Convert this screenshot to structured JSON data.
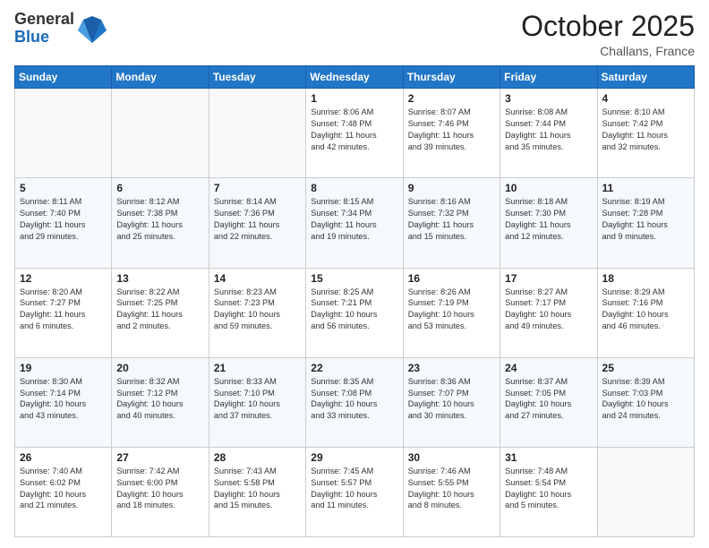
{
  "logo": {
    "general": "General",
    "blue": "Blue"
  },
  "header": {
    "month": "October 2025",
    "location": "Challans, France"
  },
  "weekdays": [
    "Sunday",
    "Monday",
    "Tuesday",
    "Wednesday",
    "Thursday",
    "Friday",
    "Saturday"
  ],
  "weeks": [
    [
      {
        "day": "",
        "info": ""
      },
      {
        "day": "",
        "info": ""
      },
      {
        "day": "",
        "info": ""
      },
      {
        "day": "1",
        "info": "Sunrise: 8:06 AM\nSunset: 7:48 PM\nDaylight: 11 hours\nand 42 minutes."
      },
      {
        "day": "2",
        "info": "Sunrise: 8:07 AM\nSunset: 7:46 PM\nDaylight: 11 hours\nand 39 minutes."
      },
      {
        "day": "3",
        "info": "Sunrise: 8:08 AM\nSunset: 7:44 PM\nDaylight: 11 hours\nand 35 minutes."
      },
      {
        "day": "4",
        "info": "Sunrise: 8:10 AM\nSunset: 7:42 PM\nDaylight: 11 hours\nand 32 minutes."
      }
    ],
    [
      {
        "day": "5",
        "info": "Sunrise: 8:11 AM\nSunset: 7:40 PM\nDaylight: 11 hours\nand 29 minutes."
      },
      {
        "day": "6",
        "info": "Sunrise: 8:12 AM\nSunset: 7:38 PM\nDaylight: 11 hours\nand 25 minutes."
      },
      {
        "day": "7",
        "info": "Sunrise: 8:14 AM\nSunset: 7:36 PM\nDaylight: 11 hours\nand 22 minutes."
      },
      {
        "day": "8",
        "info": "Sunrise: 8:15 AM\nSunset: 7:34 PM\nDaylight: 11 hours\nand 19 minutes."
      },
      {
        "day": "9",
        "info": "Sunrise: 8:16 AM\nSunset: 7:32 PM\nDaylight: 11 hours\nand 15 minutes."
      },
      {
        "day": "10",
        "info": "Sunrise: 8:18 AM\nSunset: 7:30 PM\nDaylight: 11 hours\nand 12 minutes."
      },
      {
        "day": "11",
        "info": "Sunrise: 8:19 AM\nSunset: 7:28 PM\nDaylight: 11 hours\nand 9 minutes."
      }
    ],
    [
      {
        "day": "12",
        "info": "Sunrise: 8:20 AM\nSunset: 7:27 PM\nDaylight: 11 hours\nand 6 minutes."
      },
      {
        "day": "13",
        "info": "Sunrise: 8:22 AM\nSunset: 7:25 PM\nDaylight: 11 hours\nand 2 minutes."
      },
      {
        "day": "14",
        "info": "Sunrise: 8:23 AM\nSunset: 7:23 PM\nDaylight: 10 hours\nand 59 minutes."
      },
      {
        "day": "15",
        "info": "Sunrise: 8:25 AM\nSunset: 7:21 PM\nDaylight: 10 hours\nand 56 minutes."
      },
      {
        "day": "16",
        "info": "Sunrise: 8:26 AM\nSunset: 7:19 PM\nDaylight: 10 hours\nand 53 minutes."
      },
      {
        "day": "17",
        "info": "Sunrise: 8:27 AM\nSunset: 7:17 PM\nDaylight: 10 hours\nand 49 minutes."
      },
      {
        "day": "18",
        "info": "Sunrise: 8:29 AM\nSunset: 7:16 PM\nDaylight: 10 hours\nand 46 minutes."
      }
    ],
    [
      {
        "day": "19",
        "info": "Sunrise: 8:30 AM\nSunset: 7:14 PM\nDaylight: 10 hours\nand 43 minutes."
      },
      {
        "day": "20",
        "info": "Sunrise: 8:32 AM\nSunset: 7:12 PM\nDaylight: 10 hours\nand 40 minutes."
      },
      {
        "day": "21",
        "info": "Sunrise: 8:33 AM\nSunset: 7:10 PM\nDaylight: 10 hours\nand 37 minutes."
      },
      {
        "day": "22",
        "info": "Sunrise: 8:35 AM\nSunset: 7:08 PM\nDaylight: 10 hours\nand 33 minutes."
      },
      {
        "day": "23",
        "info": "Sunrise: 8:36 AM\nSunset: 7:07 PM\nDaylight: 10 hours\nand 30 minutes."
      },
      {
        "day": "24",
        "info": "Sunrise: 8:37 AM\nSunset: 7:05 PM\nDaylight: 10 hours\nand 27 minutes."
      },
      {
        "day": "25",
        "info": "Sunrise: 8:39 AM\nSunset: 7:03 PM\nDaylight: 10 hours\nand 24 minutes."
      }
    ],
    [
      {
        "day": "26",
        "info": "Sunrise: 7:40 AM\nSunset: 6:02 PM\nDaylight: 10 hours\nand 21 minutes."
      },
      {
        "day": "27",
        "info": "Sunrise: 7:42 AM\nSunset: 6:00 PM\nDaylight: 10 hours\nand 18 minutes."
      },
      {
        "day": "28",
        "info": "Sunrise: 7:43 AM\nSunset: 5:58 PM\nDaylight: 10 hours\nand 15 minutes."
      },
      {
        "day": "29",
        "info": "Sunrise: 7:45 AM\nSunset: 5:57 PM\nDaylight: 10 hours\nand 11 minutes."
      },
      {
        "day": "30",
        "info": "Sunrise: 7:46 AM\nSunset: 5:55 PM\nDaylight: 10 hours\nand 8 minutes."
      },
      {
        "day": "31",
        "info": "Sunrise: 7:48 AM\nSunset: 5:54 PM\nDaylight: 10 hours\nand 5 minutes."
      },
      {
        "day": "",
        "info": ""
      }
    ]
  ]
}
